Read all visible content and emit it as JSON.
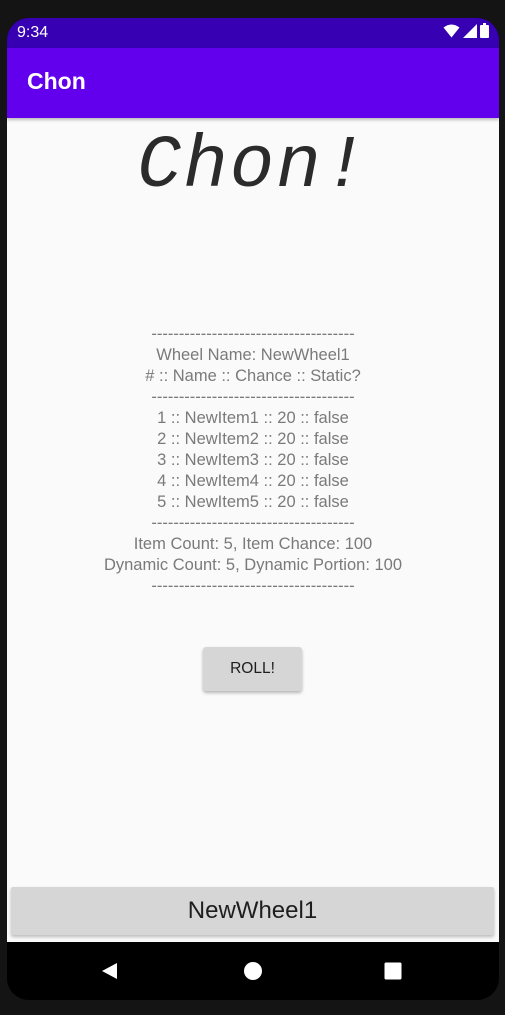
{
  "status_bar": {
    "time": "9:34",
    "icons": [
      "wifi-icon",
      "cell-signal-icon",
      "battery-icon"
    ]
  },
  "app_bar": {
    "title": "Chon",
    "color": "#6200ee"
  },
  "logo": {
    "text": "Chon!"
  },
  "wheel_info": {
    "divider": "-------------------------------------",
    "wheel_name": "Wheel Name: NewWheel1",
    "header": "# :: Name :: Chance :: Static?",
    "items": [
      "1 :: NewItem1 :: 20 :: false",
      "2 :: NewItem2 :: 20 :: false",
      "3 :: NewItem3 :: 20 :: false",
      "4 :: NewItem4 :: 20 :: false",
      "5 :: NewItem5 :: 20 :: false"
    ],
    "item_summary": "Item Count: 5, Item Chance: 100",
    "dynamic_summary": "Dynamic Count: 5, Dynamic Portion: 100"
  },
  "roll_button": {
    "label": "ROLL!"
  },
  "wheel_select_button": {
    "label": "NewWheel1"
  },
  "nav_bar": {
    "buttons": [
      "back-icon",
      "home-icon",
      "recents-icon"
    ]
  }
}
